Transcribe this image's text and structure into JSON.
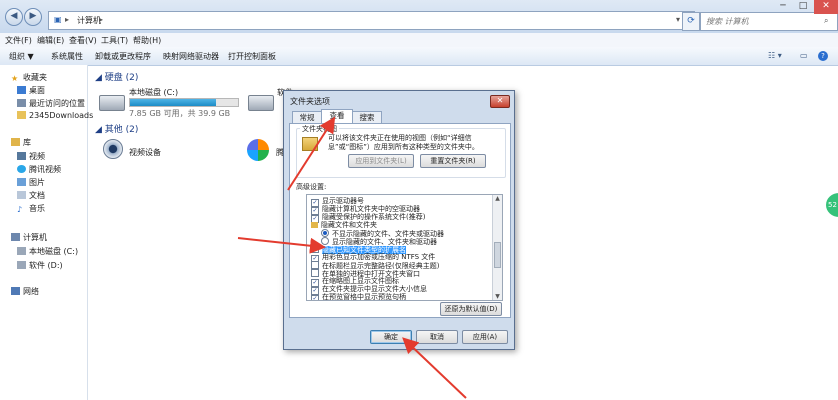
{
  "address": {
    "segments": [
      "计算机"
    ],
    "search_placeholder": "搜索 计算机"
  },
  "menu": [
    "文件(F)",
    "编辑(E)",
    "查看(V)",
    "工具(T)",
    "帮助(H)"
  ],
  "toolbar": {
    "organize": "组织 ▼",
    "items": [
      "系统属性",
      "卸载或更改程序",
      "映射网络驱动器",
      "打开控制面板"
    ]
  },
  "nav": {
    "favorites": "收藏夹",
    "desktop": "桌面",
    "recent": "最近访问的位置",
    "downloads": "2345Downloads",
    "libraries": "库",
    "videos": "视频",
    "tencent_video": "腾讯视频",
    "pictures": "图片",
    "documents": "文档",
    "music": "音乐",
    "computer": "计算机",
    "local_disk": "本地磁盘 (C:)",
    "software": "软件 (D:)",
    "network": "网络"
  },
  "content": {
    "hdd_group": "硬盘 (2)",
    "drive_c": {
      "name": "本地磁盘 (C:)",
      "free": "7.85 GB 可用，共 39.9 GB",
      "used_fraction": 0.8
    },
    "drive_d_name": "软件",
    "other_group": "其他 (2)",
    "camera": "视频设备",
    "tencent_partial": "腾"
  },
  "dialog": {
    "title": "文件夹选项",
    "tabs": [
      "常规",
      "查看",
      "搜索"
    ],
    "folder_views": {
      "heading": "文件夹视图",
      "desc": [
        "可以将该文件夹正在使用的视图（例如“详细信",
        "息”或“图标”）应用到所有这种类型的文件夹中。"
      ],
      "apply_btn": "应用到文件夹(L)",
      "reset_btn": "重置文件夹(R)"
    },
    "advanced_heading": "高级设置:",
    "advanced": [
      {
        "kind": "check",
        "checked": true,
        "text": "显示驱动器号"
      },
      {
        "kind": "check",
        "checked": true,
        "text": "隐藏计算机文件夹中的空驱动器"
      },
      {
        "kind": "check",
        "checked": true,
        "text": "隐藏受保护的操作系统文件(推荐)"
      },
      {
        "kind": "folder",
        "text": "隐藏文件和文件夹"
      },
      {
        "kind": "radio",
        "on": true,
        "text": "不显示隐藏的文件、文件夹或驱动器"
      },
      {
        "kind": "radio",
        "on": false,
        "text": "显示隐藏的文件、文件夹和驱动器"
      },
      {
        "kind": "check",
        "checked": false,
        "selected": true,
        "text": "隐藏已知文件类型的扩展名"
      },
      {
        "kind": "check",
        "checked": true,
        "text": "用彩色显示加密或压缩的 NTFS 文件"
      },
      {
        "kind": "check",
        "checked": false,
        "text": "在标题栏显示完整路径(仅限经典主题)"
      },
      {
        "kind": "check",
        "checked": false,
        "text": "在单独的进程中打开文件夹窗口"
      },
      {
        "kind": "check",
        "checked": true,
        "text": "在缩略图上显示文件图标"
      },
      {
        "kind": "check",
        "checked": true,
        "text": "在文件夹提示中显示文件大小信息"
      },
      {
        "kind": "check",
        "checked": true,
        "text": "在预览窗格中显示预览句柄"
      }
    ],
    "restore_btn": "还原为默认值(D)",
    "ok": "确定",
    "cancel": "取消",
    "apply": "应用(A)"
  },
  "floating_badge": "52",
  "colors": {
    "arrow": "#e33b2e",
    "selection": "#3399ff",
    "progress": "#1c8cc6"
  }
}
